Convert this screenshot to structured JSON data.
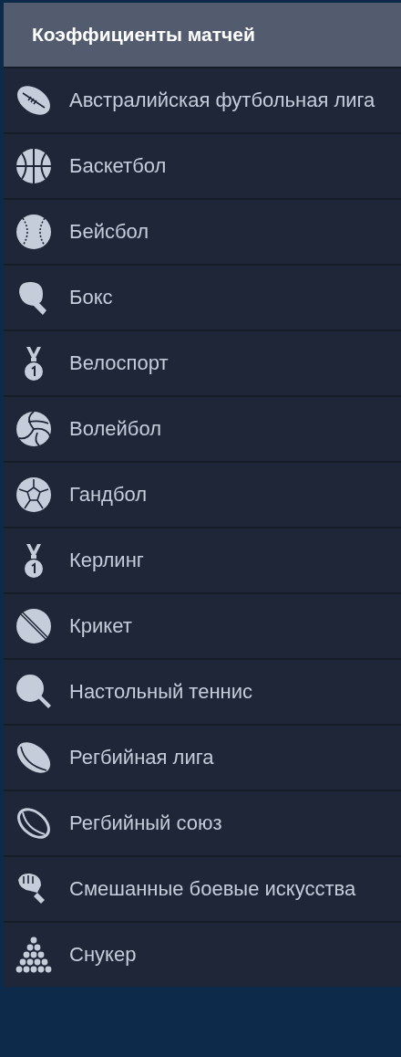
{
  "header": {
    "title": "Коэффициенты матчей"
  },
  "sports": [
    {
      "label": "Австралийская футбольная лига",
      "kind": "aussie-ball"
    },
    {
      "label": "Баскетбол",
      "kind": "basketball"
    },
    {
      "label": "Бейсбол",
      "kind": "baseball"
    },
    {
      "label": "Бокс",
      "kind": "glove"
    },
    {
      "label": "Велоспорт",
      "kind": "medal"
    },
    {
      "label": "Волейбол",
      "kind": "volleyball"
    },
    {
      "label": "Гандбол",
      "kind": "handball"
    },
    {
      "label": "Керлинг",
      "kind": "medal"
    },
    {
      "label": "Крикет",
      "kind": "cricket"
    },
    {
      "label": "Настольный теннис",
      "kind": "paddle"
    },
    {
      "label": "Регбийная лига",
      "kind": "rugby-solid"
    },
    {
      "label": "Регбийный союз",
      "kind": "rugby-outline"
    },
    {
      "label": "Смешанные боевые искусства",
      "kind": "mma-glove"
    },
    {
      "label": "Снукер",
      "kind": "snooker"
    }
  ]
}
